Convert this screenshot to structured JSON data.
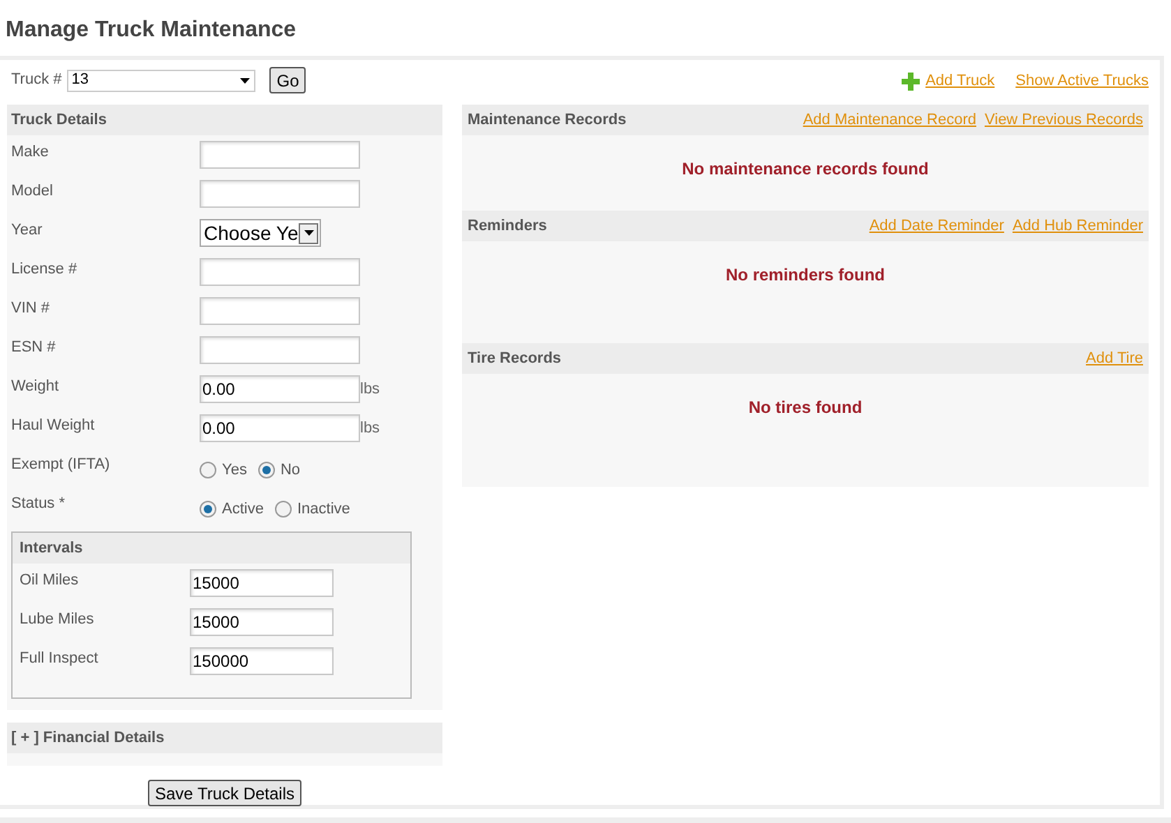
{
  "title": "Manage Truck Maintenance",
  "truck_selector": {
    "label": "Truck #",
    "value": "13",
    "go_button": "Go"
  },
  "top_links": [
    {
      "label": "Add Truck",
      "kind": "add"
    },
    {
      "label": "Show Active Trucks",
      "kind": "plain"
    }
  ],
  "truck_details": {
    "title": "Truck Details",
    "fields": [
      {
        "kind": "text",
        "label": "Make"
      },
      {
        "kind": "text",
        "label": "Model"
      },
      {
        "kind": "select",
        "label": "Year",
        "value": "Choose Ye"
      },
      {
        "kind": "text",
        "label": "License #"
      },
      {
        "kind": "text",
        "label": "VIN #"
      },
      {
        "kind": "text",
        "label": "ESN #"
      },
      {
        "kind": "text",
        "label": "Weight",
        "value": "0.00",
        "unit": "lbs"
      },
      {
        "kind": "text",
        "label": "Haul Weight",
        "value": "0.00",
        "unit": "lbs"
      },
      {
        "kind": "radio",
        "label": "Exempt (IFTA)",
        "options": [
          {
            "label": "Yes",
            "selected": false
          },
          {
            "label": "No",
            "selected": true
          }
        ]
      },
      {
        "kind": "radio",
        "label": "Status *",
        "options": [
          {
            "label": "Active",
            "selected": true
          },
          {
            "label": "Inactive",
            "selected": false
          }
        ]
      }
    ],
    "intervals": {
      "title": "Intervals",
      "fields": [
        {
          "label": "Oil Miles",
          "value": "15000"
        },
        {
          "label": "Lube Miles",
          "value": "15000"
        },
        {
          "label": "Full Inspect",
          "value": "150000"
        }
      ]
    }
  },
  "financial": {
    "title": "[ + ] Financial Details"
  },
  "save_button": "Save Truck Details",
  "sections": [
    {
      "title": "Maintenance Records",
      "links": [
        "Add Maintenance Record",
        "View Previous Records"
      ],
      "empty_message": "No maintenance records found"
    },
    {
      "title": "Reminders",
      "links": [
        "Add Date Reminder",
        "Add Hub Reminder"
      ],
      "empty_message": "No reminders found"
    },
    {
      "title": "Tire Records",
      "links": [
        "Add Tire"
      ],
      "empty_message": "No tires found"
    }
  ]
}
